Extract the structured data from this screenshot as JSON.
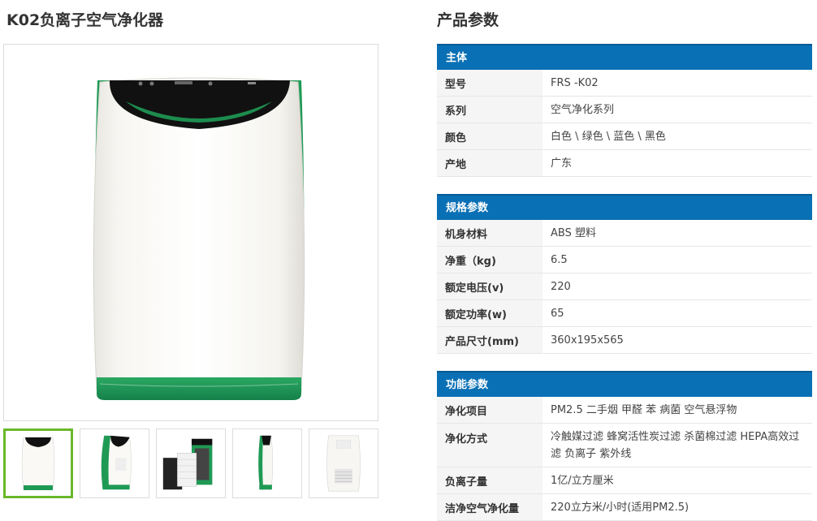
{
  "product": {
    "title": "K02负离子空气净化器"
  },
  "gallery": {
    "thumbnails": [
      {
        "name": "front"
      },
      {
        "name": "side-angle"
      },
      {
        "name": "filters"
      },
      {
        "name": "profile"
      },
      {
        "name": "back"
      }
    ],
    "active_index": 0
  },
  "params": {
    "heading": "产品参数",
    "sections": [
      {
        "title": "主体",
        "rows": [
          {
            "key": "型号",
            "value": "FRS -K02"
          },
          {
            "key": "系列",
            "value": "空气净化系列"
          },
          {
            "key": "颜色",
            "value": "白色 \\ 绿色 \\ 蓝色 \\ 黑色"
          },
          {
            "key": "产地",
            "value": "广东"
          }
        ]
      },
      {
        "title": "规格参数",
        "rows": [
          {
            "key": "机身材料",
            "value": "ABS 塑料"
          },
          {
            "key": "净重（kg)",
            "value": "6.5"
          },
          {
            "key": "额定电压(v)",
            "value": "220"
          },
          {
            "key": "额定功率(w)",
            "value": "65"
          },
          {
            "key": "产品尺寸(mm)",
            "value": "360x195x565"
          }
        ]
      },
      {
        "title": "功能参数",
        "rows": [
          {
            "key": "净化项目",
            "value": "PM2.5 二手烟 甲醛 苯 病菌 空气悬浮物"
          },
          {
            "key": "净化方式",
            "value": "冷触媒过滤 蜂窝活性炭过滤 杀菌棉过滤 HEPA高效过滤 负离子 紫外线"
          },
          {
            "key": "负离子量",
            "value": "1亿/立方厘米"
          },
          {
            "key": "洁净空气净化量",
            "value": "220立方米/小时(适用PM2.5)"
          }
        ]
      }
    ]
  },
  "colors": {
    "header_blue": "#0a70b5",
    "thumb_active_border": "#6ab82a",
    "accent_green": "#1f9a55"
  }
}
